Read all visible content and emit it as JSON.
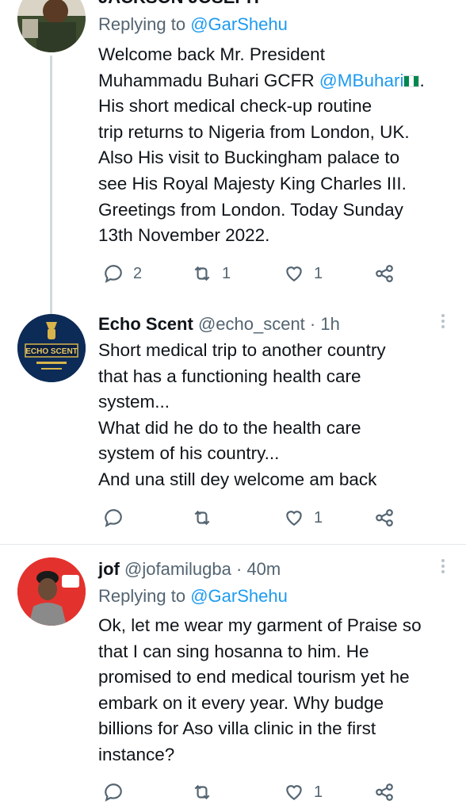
{
  "tweets": [
    {
      "name": "JACKSON JOSEPH",
      "handle": "",
      "time": "",
      "replying_prefix": "Replying to ",
      "replying_to": "@GarShehu",
      "text_1": "Welcome back Mr. President\nMuhammadu Buhari GCFR ",
      "mention": "@MBuhari",
      "text_2": ". His short medical check-up routine\ntrip returns to Nigeria from London, UK.\nAlso His visit to Buckingham palace to\nsee His Royal Majesty King Charles III.\nGreetings from London. Today Sunday\n13th November 2022.",
      "replies": "2",
      "retweets": "1",
      "likes": "1"
    },
    {
      "name": "Echo Scent",
      "handle": "@echo_scent",
      "sep": " · ",
      "time": "1h",
      "avatar_text": "ECHO SCENT",
      "text": "Short medical trip to another country\nthat has a functioning health care\nsystem...\nWhat did he do to the health care\nsystem of his country...\nAnd una still dey welcome am back",
      "replies": "",
      "retweets": "",
      "likes": "1"
    },
    {
      "name": "jof",
      "handle": "@jofamilugba",
      "sep": " · ",
      "time": "40m",
      "replying_prefix": "Replying to ",
      "replying_to": "@GarShehu",
      "text": "Ok, let me wear my garment of Praise so\nthat I can sing hosanna to him. He\npromised to end medical tourism yet he\nembark on it every year. Why budge\nbillions for Aso villa clinic in the first\ninstance?",
      "replies": "",
      "retweets": "",
      "likes": "1"
    }
  ],
  "colors": {
    "link": "#1d9bf0",
    "muted": "#536471",
    "divider": "#e4e9ec",
    "thread_line": "#cfd9de"
  },
  "icons": [
    "reply-icon",
    "retweet-icon",
    "like-icon",
    "share-icon",
    "more-icon"
  ]
}
